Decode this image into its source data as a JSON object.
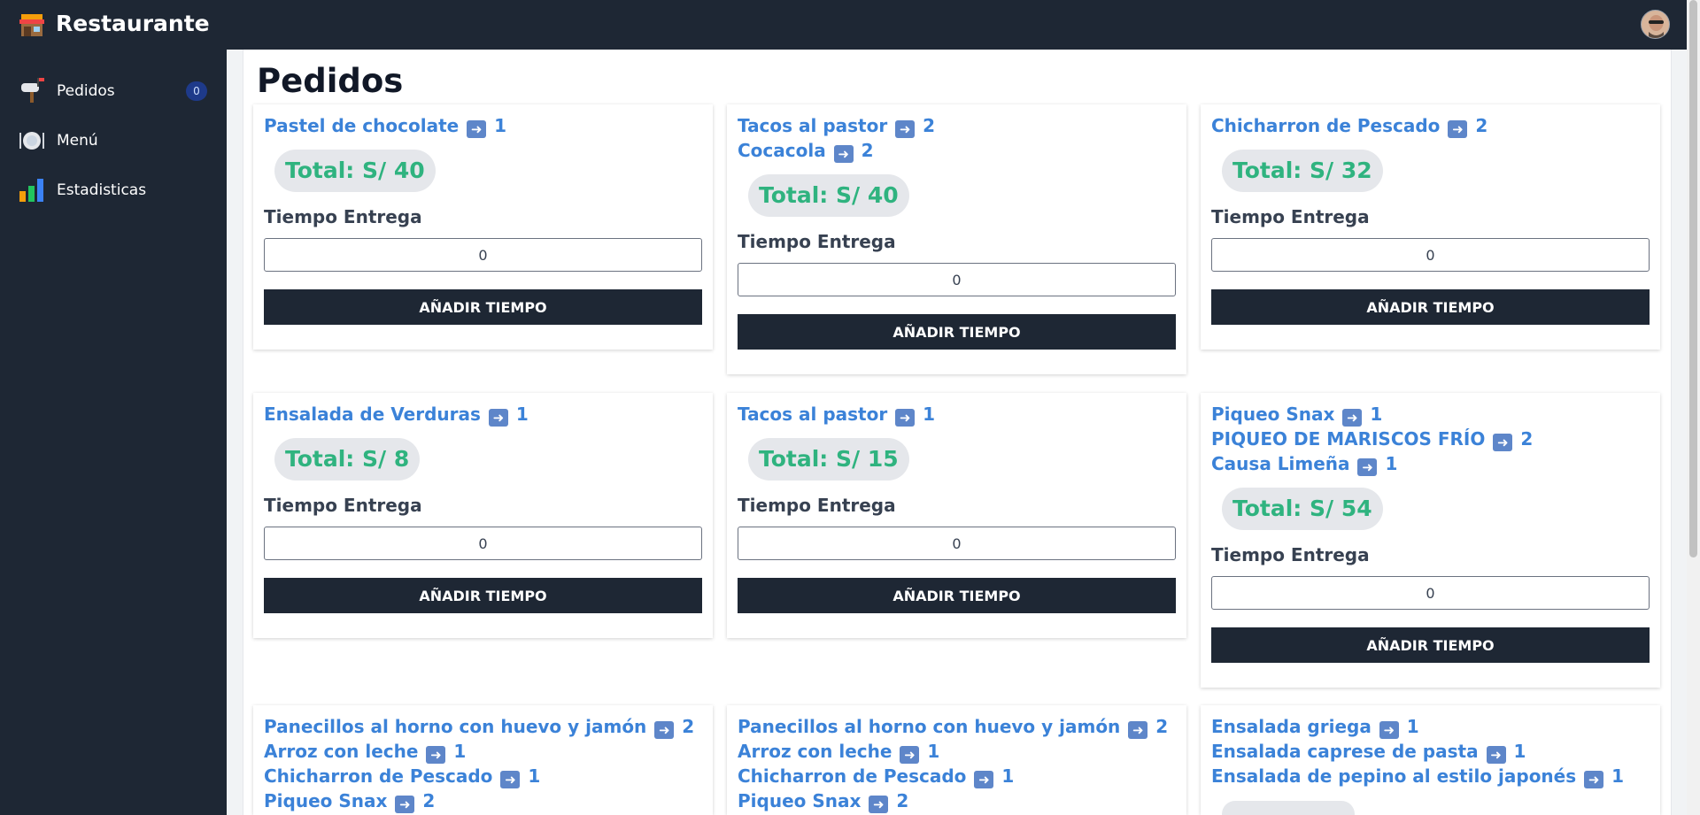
{
  "app": {
    "title": "Restaurante"
  },
  "sidebar": {
    "items": [
      {
        "label": "Pedidos",
        "icon": "mailbox-icon",
        "badge": "0"
      },
      {
        "label": "Menú",
        "icon": "plate-cutlery-icon"
      },
      {
        "label": "Estadisticas",
        "icon": "bar-chart-icon"
      }
    ]
  },
  "page": {
    "title": "Pedidos"
  },
  "common": {
    "time_label": "Tiempo Entrega",
    "button_label": "AÑADIR TIEMPO"
  },
  "orders": [
    {
      "items": [
        {
          "name": "Pastel de chocolate",
          "qty": "1"
        }
      ],
      "total": "Total: S/ 40",
      "time_value": "0"
    },
    {
      "items": [
        {
          "name": "Tacos al pastor",
          "qty": "2"
        },
        {
          "name": "Cocacola",
          "qty": "2"
        }
      ],
      "total": "Total: S/ 40",
      "time_value": "0"
    },
    {
      "items": [
        {
          "name": "Chicharron de Pescado",
          "qty": "2"
        }
      ],
      "total": "Total: S/ 32",
      "time_value": "0"
    },
    {
      "items": [
        {
          "name": "Ensalada de Verduras",
          "qty": "1"
        }
      ],
      "total": "Total: S/ 8",
      "time_value": "0"
    },
    {
      "items": [
        {
          "name": "Tacos al pastor",
          "qty": "1"
        }
      ],
      "total": "Total: S/ 15",
      "time_value": "0"
    },
    {
      "items": [
        {
          "name": "Piqueo Snax",
          "qty": "1"
        },
        {
          "name": "PIQUEO DE MARISCOS FRÍO",
          "qty": "2"
        },
        {
          "name": "Causa Limeña",
          "qty": "1"
        }
      ],
      "total": "Total: S/ 54",
      "time_value": "0"
    },
    {
      "items": [
        {
          "name": "Panecillos al horno con huevo y jamón",
          "qty": "2"
        },
        {
          "name": "Arroz con leche",
          "qty": "1"
        },
        {
          "name": "Chicharron de Pescado",
          "qty": "1"
        },
        {
          "name": "Piqueo Snax",
          "qty": "2"
        }
      ]
    },
    {
      "items": [
        {
          "name": "Panecillos al horno con huevo y jamón",
          "qty": "2"
        },
        {
          "name": "Arroz con leche",
          "qty": "1"
        },
        {
          "name": "Chicharron de Pescado",
          "qty": "1"
        },
        {
          "name": "Piqueo Snax",
          "qty": "2"
        }
      ]
    },
    {
      "items": [
        {
          "name": "Ensalada griega",
          "qty": "1"
        },
        {
          "name": "Ensalada caprese de pasta",
          "qty": "1"
        },
        {
          "name": "Ensalada de pepino al estilo japonés",
          "qty": "1"
        }
      ]
    }
  ],
  "colors": {
    "nav_bg": "#1e2734",
    "item_link": "#3b82d8",
    "total_text": "#2fb37f",
    "button_bg": "#1e2734"
  }
}
